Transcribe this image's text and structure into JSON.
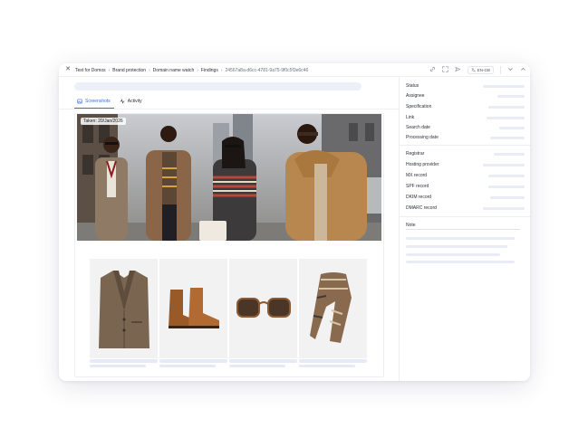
{
  "window": {
    "breadcrumbs": [
      "Test for Domos",
      "Brand protection",
      "Domain name watch",
      "Findings",
      "24567a8a-d6cc-4781-9a75-9f0c5f3e6c46"
    ],
    "language": "EN-GB"
  },
  "tabs": [
    {
      "label": "Screenshots",
      "icon": "image-icon",
      "active": true
    },
    {
      "label": "Activity",
      "icon": "activity-icon",
      "active": false
    }
  ],
  "screenshot": {
    "taken_label": "Taken: 20/Jan/2026"
  },
  "products": [
    {
      "icon": "blazer-image"
    },
    {
      "icon": "boots-image"
    },
    {
      "icon": "sunglasses-image"
    },
    {
      "icon": "scarf-image"
    }
  ],
  "details": {
    "group1": [
      "Status",
      "Assignee",
      "Specification",
      "Link",
      "Search date",
      "Processing date"
    ],
    "group2": [
      "Registrar",
      "Hosting provider",
      "MX record",
      "SPF record",
      "DKIM record",
      "DMARC record"
    ],
    "note_label": "Note"
  },
  "colors": {
    "accent": "#3a6fd8",
    "placeholder": "#e9ecf5"
  }
}
